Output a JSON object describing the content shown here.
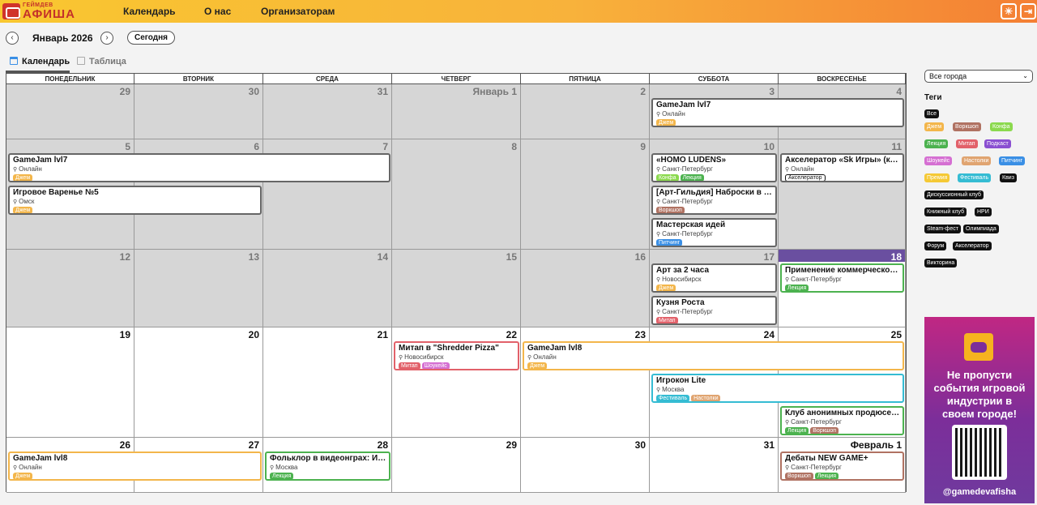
{
  "header": {
    "logo_small": "ГЕЙМДЕВ",
    "logo_big": "АФИША",
    "nav": [
      "Календарь",
      "О нас",
      "Организаторам"
    ]
  },
  "toolbar": {
    "prev": "‹",
    "next": "›",
    "month_title": "Январь 2026",
    "today_label": "Сегодня"
  },
  "view_tabs": [
    "Календарь",
    "Таблица"
  ],
  "weekdays": [
    "ПОНЕДЕЛЬНИК",
    "ВТОРНИК",
    "СРЕДА",
    "ЧЕТВЕРГ",
    "ПЯТНИЦА",
    "СУББОТА",
    "ВОСКРЕСЕНЬЕ"
  ],
  "weeks": [
    [
      {
        "n": "29",
        "other": true
      },
      {
        "n": "30",
        "other": true
      },
      {
        "n": "31",
        "other": true
      },
      {
        "n": "Январь 1"
      },
      {
        "n": "2"
      },
      {
        "n": "3"
      },
      {
        "n": "4"
      }
    ],
    [
      {
        "n": "5"
      },
      {
        "n": "6"
      },
      {
        "n": "7"
      },
      {
        "n": "8"
      },
      {
        "n": "9"
      },
      {
        "n": "10"
      },
      {
        "n": "11"
      }
    ],
    [
      {
        "n": "12"
      },
      {
        "n": "13"
      },
      {
        "n": "14"
      },
      {
        "n": "15"
      },
      {
        "n": "16"
      },
      {
        "n": "17"
      },
      {
        "n": "18",
        "today": true
      }
    ],
    [
      {
        "n": "19"
      },
      {
        "n": "20"
      },
      {
        "n": "21"
      },
      {
        "n": "22"
      },
      {
        "n": "23"
      },
      {
        "n": "24"
      },
      {
        "n": "25"
      }
    ],
    [
      {
        "n": "26"
      },
      {
        "n": "27"
      },
      {
        "n": "28"
      },
      {
        "n": "29"
      },
      {
        "n": "30"
      },
      {
        "n": "31"
      },
      {
        "n": "Февраль 1"
      }
    ]
  ],
  "past_through": {
    "week": 2,
    "day": 5
  },
  "events": [
    {
      "week": 0,
      "slot": 0,
      "start": 5,
      "span": 2,
      "title": "GameJam lvl7",
      "loc": "Онлайн",
      "tags": [
        "Джем"
      ],
      "color": "#666"
    },
    {
      "week": 1,
      "slot": 0,
      "start": 0,
      "span": 3,
      "title": "GameJam lvl7",
      "loc": "Онлайн",
      "tags": [
        "Джем"
      ],
      "color": "#666"
    },
    {
      "week": 1,
      "slot": 1,
      "start": 0,
      "span": 2,
      "title": "Игровое Варенье №5",
      "loc": "Омск",
      "tags": [
        "Джем"
      ],
      "color": "#666"
    },
    {
      "week": 1,
      "slot": 0,
      "start": 5,
      "span": 1,
      "title": "«HOMO LUDENS»",
      "loc": "Санкт-Петербург",
      "tags": [
        "Конфа",
        "Лекция"
      ],
      "color": "#666"
    },
    {
      "week": 1,
      "slot": 1,
      "start": 5,
      "span": 1,
      "title": "[Арт-Гильдия] Наброски в метро",
      "loc": "Санкт-Петербург",
      "tags": [
        "Воркшоп"
      ],
      "color": "#666"
    },
    {
      "week": 1,
      "slot": 2,
      "start": 5,
      "span": 1,
      "title": "Мастерская идей",
      "loc": "Санкт-Петербург",
      "tags": [
        "Питчинг"
      ],
      "color": "#666"
    },
    {
      "week": 1,
      "slot": 0,
      "start": 6,
      "span": 1,
      "title": "Акселератор «Sk Игры» (конец набора)",
      "loc": "Онлайн",
      "tags": [
        "Акселератор"
      ],
      "color": "#666"
    },
    {
      "week": 2,
      "slot": 0,
      "start": 5,
      "span": 1,
      "title": "Арт за 2 часа",
      "loc": "Новосибирск",
      "tags": [
        "Джем"
      ],
      "color": "#666"
    },
    {
      "week": 2,
      "slot": 1,
      "start": 5,
      "span": 1,
      "title": "Кузня Роста",
      "loc": "Санкт-Петербург",
      "tags": [
        "Митап"
      ],
      "color": "#666"
    },
    {
      "week": 2,
      "slot": 0,
      "start": 6,
      "span": 1,
      "title": "Применение коммерческого подхода",
      "loc": "Санкт-Петербург",
      "tags": [
        "Лекция"
      ],
      "color": "#4cb24f"
    },
    {
      "week": 3,
      "slot": 0,
      "start": 3,
      "span": 1,
      "title": "Митап в \"Shredder Pizza\"",
      "loc": "Новосибирск",
      "tags": [
        "Митап",
        "Шоукейс"
      ],
      "color": "#e2616a"
    },
    {
      "week": 3,
      "slot": 0,
      "start": 4,
      "span": 3,
      "title": "GameJam lvl8",
      "loc": "Онлайн",
      "tags": [
        "Джем"
      ],
      "color": "#f3b64b"
    },
    {
      "week": 3,
      "slot": 1,
      "start": 5,
      "span": 2,
      "title": "Игрокон Lite",
      "loc": "Москва",
      "tags": [
        "Фестиваль",
        "Настолки"
      ],
      "color": "#35bcd3"
    },
    {
      "week": 3,
      "slot": 2,
      "start": 6,
      "span": 1,
      "title": "Клуб анонимных продюсеров: Лекция",
      "loc": "Санкт-Петербург",
      "tags": [
        "Лекция",
        "Воркшоп"
      ],
      "color": "#4cb24f"
    },
    {
      "week": 4,
      "slot": 0,
      "start": 0,
      "span": 2,
      "title": "GameJam lvl8",
      "loc": "Онлайн",
      "tags": [
        "Джем"
      ],
      "color": "#f3b64b"
    },
    {
      "week": 4,
      "slot": 0,
      "start": 2,
      "span": 1,
      "title": "Фольклор в видеонграх: История",
      "loc": "Москва",
      "tags": [
        "Лекция"
      ],
      "color": "#4cb24f"
    },
    {
      "week": 4,
      "slot": 0,
      "start": 6,
      "span": 1,
      "title": "Дебаты NEW GAME+",
      "loc": "Санкт-Петербург",
      "tags": [
        "Воркшоп",
        "Лекция"
      ],
      "color": "#b07262"
    }
  ],
  "tag_colors": {
    "Все": "#111",
    "Джем": "#f3b64b",
    "Воркшоп": "#b07262",
    "Конфа": "#8bd94e",
    "Лекция": "#4cb24f",
    "Митап": "#e2616a",
    "Подкаст": "#8a4fd1",
    "Шоукейс": "#d56fd2",
    "Настолки": "#e0a470",
    "Питчинг": "#3a8fe5",
    "Премия": "#f5c935",
    "Фестиваль": "#35bcd3",
    "Квиз": "#111",
    "Дискуссионный клуб": "#111",
    "Книжный клуб": "#111",
    "НРИ": "#111",
    "Steam-фест": "#111",
    "Олимпиада": "#111",
    "Форум": "#111",
    "Акселератор": "#111",
    "Викторина": "#111"
  },
  "sidebar": {
    "city_select": "Все города",
    "tags_title": "Теги",
    "tags": [
      "Все",
      "Джем",
      "Воркшоп",
      "Конфа",
      "Лекция",
      "Митап",
      "Подкаст",
      "Шоукейс",
      "Настолки",
      "Питчинг",
      "Премия",
      "Фестиваль",
      "Квиз",
      "Дискуссионный клуб",
      "Книжный клуб",
      "НРИ",
      "Steam-фест",
      "Олимпиада",
      "Форум",
      "Акселератор",
      "Викторина"
    ],
    "promo_text": "Не пропусти события игровой индустрии в своем городе!",
    "promo_handle": "@gamedevafisha"
  }
}
